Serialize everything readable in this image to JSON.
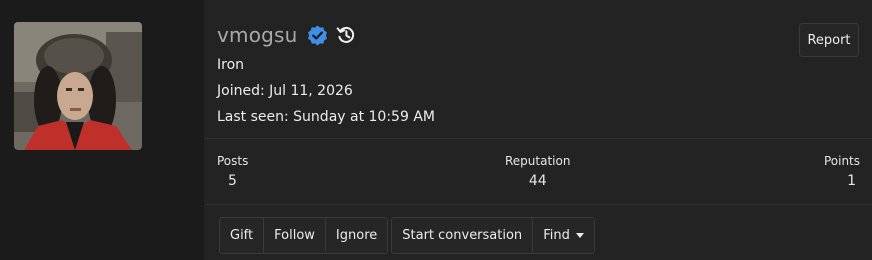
{
  "profile": {
    "username": "vmogsu",
    "verified_icon": "verified-check-icon",
    "history_icon": "username-history-icon",
    "user_title": "Iron",
    "joined": "Joined: Jul 11, 2026",
    "last_seen": "Last seen: Sunday at 10:59 AM"
  },
  "report_label": "Report",
  "stats": {
    "posts_label": "Posts",
    "posts_value": "5",
    "reputation_label": "Reputation",
    "reputation_value": "44",
    "points_label": "Points",
    "points_value": "1"
  },
  "actions": {
    "gift": "Gift",
    "follow": "Follow",
    "ignore": "Ignore",
    "start_conversation": "Start conversation",
    "find": "Find"
  },
  "colors": {
    "background": "#232323",
    "verified_blue": "#3f8fe5",
    "username_gray": "#a9a9a9"
  }
}
